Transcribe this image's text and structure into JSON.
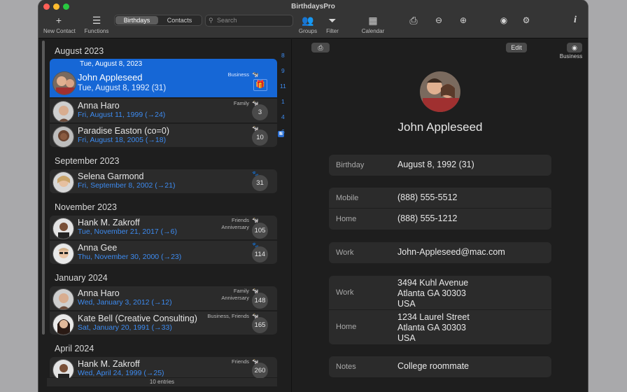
{
  "window": {
    "title": "BirthdaysPro"
  },
  "toolbar": {
    "new_contact": "New Contact",
    "functions": "Functions",
    "tab_birthdays": "Birthdays",
    "tab_contacts": "Contacts",
    "search_placeholder": "Search",
    "groups": "Groups",
    "filter": "Filter",
    "calendar": "Calendar",
    "icons": [
      "plus-icon",
      "menu-icon",
      "groups-icon",
      "filter-icon",
      "calendar-icon",
      "print-icon",
      "zoom-out-icon",
      "zoom-in-icon",
      "eye-icon",
      "gear-icon",
      "info-icon"
    ]
  },
  "list": {
    "months": [
      "August 2023",
      "September 2023",
      "November 2023",
      "January 2024",
      "April 2024"
    ],
    "selected_header": "Tue, August 8, 2023",
    "rows": [
      {
        "name": "John Appleseed",
        "date": "Tue, August 8, 1992 (31)",
        "tag": "Business",
        "tag2": "",
        "count": ""
      },
      {
        "name": "Anna Haro",
        "date": "Fri, August 11, 1999 (→24)",
        "tag": "Family",
        "tag2": "",
        "count": "3"
      },
      {
        "name": "Paradise Easton (co=0)",
        "date": "Fri, August 18, 2005 (→18)",
        "tag": "",
        "tag2": "",
        "count": "10"
      },
      {
        "name": "Selena Garmond",
        "date": "Fri, September 8, 2002 (→21)",
        "tag": "",
        "tag2": "",
        "count": "31"
      },
      {
        "name": "Hank M. Zakroff",
        "date": "Tue, November 21, 2017 (→6)",
        "tag": "Friends",
        "tag2": "Anniversary",
        "count": "105"
      },
      {
        "name": "Anna Gee",
        "date": "Thu, November 30, 2000 (→23)",
        "tag": "",
        "tag2": "",
        "count": "114"
      },
      {
        "name": "Anna Haro",
        "date": "Wed, January 3, 2012 (→12)",
        "tag": "Family",
        "tag2": "Anniversary",
        "count": "148"
      },
      {
        "name": "Kate Bell (Creative Consulting)",
        "date": "Sat, January 20, 1991 (→33)",
        "tag": "Business, Friends",
        "tag2": "",
        "count": "165"
      },
      {
        "name": "Hank M. Zakroff",
        "date": "Wed, April 24, 1999 (→25)",
        "tag": "Friends",
        "tag2": "",
        "count": "260"
      }
    ],
    "index": [
      "8",
      "9",
      "11",
      "1",
      "4",
      "6"
    ],
    "footer": "10 entries"
  },
  "detail": {
    "edit_label": "Edit",
    "business_label": "Business",
    "name": "John Appleseed",
    "birthday": {
      "label": "Birthday",
      "value": "August 8, 1992 (31)"
    },
    "mobile": {
      "label": "Mobile",
      "value": "(888) 555-5512"
    },
    "home_phone": {
      "label": "Home",
      "value": "(888) 555-1212"
    },
    "work_email": {
      "label": "Work",
      "value": "John-Appleseed@mac.com"
    },
    "work_address": {
      "label": "Work",
      "value": "3494 Kuhl Avenue\nAtlanta GA 30303\nUSA"
    },
    "home_address": {
      "label": "Home",
      "value": "1234 Laurel Street\nAtlanta GA 30303\nUSA"
    },
    "notes": {
      "label": "Notes",
      "value": "College roommate"
    }
  },
  "colors": {
    "accent": "#1667d6",
    "link": "#3d8bf0",
    "background": "#1e1e1e",
    "row": "#2b2b2b"
  }
}
